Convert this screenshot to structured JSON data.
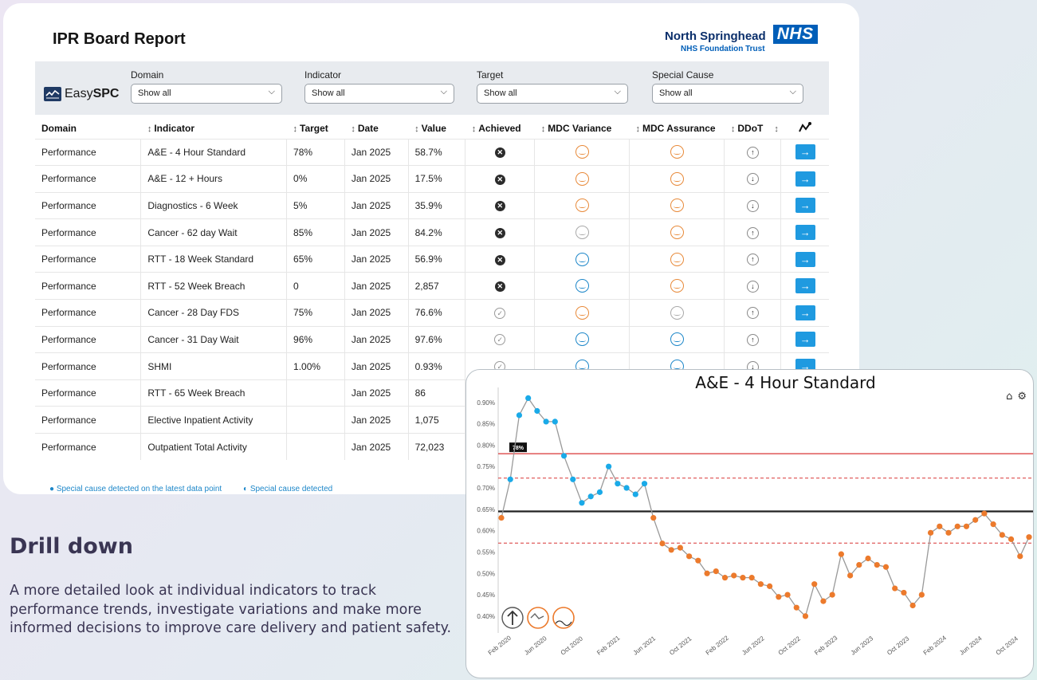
{
  "report": {
    "title": "IPR Board Report",
    "org_name": "North Springhead",
    "org_logo": "NHS",
    "org_sub": "NHS Foundation Trust",
    "brand_plain": "Easy",
    "brand_bold": "SPC"
  },
  "filters": [
    {
      "label": "Domain",
      "value": "Show all"
    },
    {
      "label": "Indicator",
      "value": "Show all"
    },
    {
      "label": "Target",
      "value": "Show all"
    },
    {
      "label": "Special Cause",
      "value": "Show all"
    }
  ],
  "table": {
    "headers": [
      "Domain",
      "Indicator",
      "Target",
      "Date",
      "Value",
      "Achieved",
      "MDC Variance",
      "MDC Assurance",
      "DDoT"
    ],
    "rows": [
      {
        "domain": "Performance",
        "indicator": "A&E - 4 Hour Standard",
        "target": "78%",
        "date": "Jan 2025",
        "value": "58.7%",
        "achieved": "fail",
        "variance": "orange",
        "assurance": "orange",
        "ddot": "up"
      },
      {
        "domain": "Performance",
        "indicator": "A&E - 12 + Hours",
        "target": "0%",
        "date": "Jan 2025",
        "value": "17.5%",
        "achieved": "fail",
        "variance": "orange",
        "assurance": "orange",
        "ddot": "down"
      },
      {
        "domain": "Performance",
        "indicator": "Diagnostics - 6 Week",
        "target": "5%",
        "date": "Jan 2025",
        "value": "35.9%",
        "achieved": "fail",
        "variance": "orange",
        "assurance": "orange",
        "ddot": "down"
      },
      {
        "domain": "Performance",
        "indicator": "Cancer - 62 day Wait",
        "target": "85%",
        "date": "Jan 2025",
        "value": "84.2%",
        "achieved": "fail",
        "variance": "grey",
        "assurance": "orange",
        "ddot": "up"
      },
      {
        "domain": "Performance",
        "indicator": "RTT - 18 Week Standard",
        "target": "65%",
        "date": "Jan 2025",
        "value": "56.9%",
        "achieved": "fail",
        "variance": "blue",
        "assurance": "orange",
        "ddot": "up"
      },
      {
        "domain": "Performance",
        "indicator": "RTT - 52 Week Breach",
        "target": "0",
        "date": "Jan 2025",
        "value": "2,857",
        "achieved": "fail",
        "variance": "blue",
        "assurance": "orange",
        "ddot": "down"
      },
      {
        "domain": "Performance",
        "indicator": "Cancer - 28 Day FDS",
        "target": "75%",
        "date": "Jan 2025",
        "value": "76.6%",
        "achieved": "pass",
        "variance": "orange",
        "assurance": "grey",
        "ddot": "up"
      },
      {
        "domain": "Performance",
        "indicator": "Cancer - 31 Day Wait",
        "target": "96%",
        "date": "Jan 2025",
        "value": "97.6%",
        "achieved": "pass",
        "variance": "blue",
        "assurance": "blue",
        "ddot": "up"
      },
      {
        "domain": "Performance",
        "indicator": "SHMI",
        "target": "1.00%",
        "date": "Jan 2025",
        "value": "0.93%",
        "achieved": "pass",
        "variance": "blue",
        "assurance": "blue",
        "ddot": "down"
      },
      {
        "domain": "Performance",
        "indicator": "RTT - 65 Week Breach",
        "target": "",
        "date": "Jan 2025",
        "value": "86",
        "achieved": "",
        "variance": "",
        "assurance": "",
        "ddot": ""
      },
      {
        "domain": "Performance",
        "indicator": "Elective Inpatient Activity",
        "target": "",
        "date": "Jan 2025",
        "value": "1,075",
        "achieved": "",
        "variance": "",
        "assurance": "",
        "ddot": ""
      },
      {
        "domain": "Performance",
        "indicator": "Outpatient Total Activity",
        "target": "",
        "date": "Jan 2025",
        "value": "72,023",
        "achieved": "",
        "variance": "",
        "assurance": "",
        "ddot": ""
      }
    ]
  },
  "legend": {
    "latest": "Special cause detected on the latest data point",
    "detected": "Special cause detected"
  },
  "drill": {
    "title": "Drill down",
    "text": "A more detailed look at individual indicators to track performance trends, investigate variations and make more informed decisions to improve care delivery and patient safety."
  },
  "colors": {
    "accent": "#1f9ae0",
    "special_high": "#1aaae8",
    "special_low": "#ec7a2c",
    "target_line": "#d93636",
    "nhs_blue": "#005eb8"
  },
  "chart_data": {
    "type": "line",
    "title": "A&E - 4 Hour Standard",
    "target_label": "78%",
    "ylim": [
      0.37,
      0.935
    ],
    "yticks": [
      "0.90%",
      "0.85%",
      "0.80%",
      "0.75%",
      "0.70%",
      "0.65%",
      "0.60%",
      "0.55%",
      "0.50%",
      "0.45%",
      "0.40%"
    ],
    "ytick_values": [
      0.9,
      0.85,
      0.8,
      0.75,
      0.7,
      0.65,
      0.6,
      0.55,
      0.5,
      0.45,
      0.4
    ],
    "xticks": [
      "Feb 2020",
      "Jun 2020",
      "Oct 2020",
      "Feb 2021",
      "Jun 2021",
      "Oct 2021",
      "Feb 2022",
      "Jun 2022",
      "Oct 2022",
      "Feb 2023",
      "Jun 2023",
      "Oct 2023",
      "Feb 2024",
      "Jun 2024",
      "Oct 2024"
    ],
    "target": 0.78,
    "mean": 0.645,
    "upper_limit": 0.723,
    "lower_limit": 0.571,
    "series": [
      {
        "values": [
          0.63,
          0.72,
          0.87,
          0.91,
          0.88,
          0.855,
          0.855,
          0.775,
          0.72,
          0.665,
          0.68,
          0.69,
          0.75,
          0.71,
          0.7,
          0.685,
          0.71,
          0.63,
          0.57,
          0.555,
          0.56,
          0.54,
          0.53,
          0.5,
          0.505,
          0.49,
          0.495,
          0.49,
          0.49,
          0.475,
          0.47,
          0.445,
          0.45,
          0.42,
          0.4,
          0.475,
          0.435,
          0.45,
          0.545,
          0.495,
          0.52,
          0.535,
          0.52,
          0.515,
          0.465,
          0.455,
          0.425,
          0.45,
          0.595,
          0.61,
          0.595,
          0.61,
          0.61,
          0.625,
          0.64,
          0.615,
          0.59,
          0.58,
          0.54,
          0.585
        ]
      }
    ],
    "point_colors": [
      "orange",
      "blue",
      "blue",
      "blue",
      "blue",
      "blue",
      "blue",
      "blue",
      "blue",
      "blue",
      "blue",
      "blue",
      "blue",
      "blue",
      "blue",
      "blue",
      "blue",
      "orange",
      "orange",
      "orange",
      "orange",
      "orange",
      "orange",
      "orange",
      "orange",
      "orange",
      "orange",
      "orange",
      "orange",
      "orange",
      "orange",
      "orange",
      "orange",
      "orange",
      "orange",
      "orange",
      "orange",
      "orange",
      "orange",
      "orange",
      "orange",
      "orange",
      "orange",
      "orange",
      "orange",
      "orange",
      "orange",
      "orange",
      "orange",
      "orange",
      "orange",
      "orange",
      "orange",
      "orange",
      "orange",
      "orange",
      "orange",
      "orange",
      "orange",
      "orange"
    ]
  }
}
